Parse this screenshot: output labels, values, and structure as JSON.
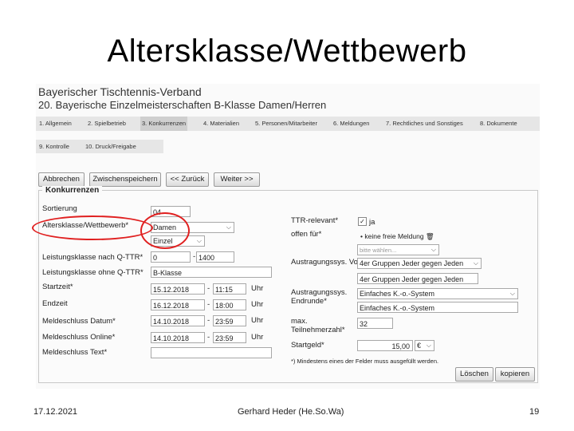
{
  "slide": {
    "title": "Altersklasse/Wettbewerb",
    "footer_date": "17.12.2021",
    "footer_author": "Gerhard Heder (He.So.Wa)",
    "footer_page": "19"
  },
  "header": {
    "org": "Bayerischer Tischtennis-Verband",
    "event": "20. Bayerische Einzelmeisterschaften B-Klasse Damen/Herren"
  },
  "tabs": [
    "1. Allgemein",
    "2. Spielbetrieb",
    "3. Konkurrenzen",
    "4. Materialien",
    "5. Personen/Mitarbeiter",
    "6. Meldungen",
    "7. Rechtliches und Sonstiges",
    "8. Dokumente",
    "9. Kontrolle",
    "10. Druck/Freigabe"
  ],
  "toolbar": {
    "cancel": "Abbrechen",
    "save_draft": "Zwischenspeichern",
    "back": "<< Zurück",
    "next": "Weiter >>"
  },
  "form": {
    "legend": "Konkurrenzen",
    "sort_label": "Sortierung",
    "sort_value": "04",
    "agegroup_label": "Altersklasse/Wettbewerb*",
    "agegroup_value": "Damen",
    "type_value": "Einzel",
    "ttr_label": "Leistungsklasse nach Q-TTR*",
    "ttr_from": "0",
    "ttr_to": "1400",
    "class_label": "Leistungsklasse ohne Q-TTR*",
    "class_value": "B-Klasse",
    "start_label": "Startzeit*",
    "start_date": "15.12.2018",
    "start_time": "11:15",
    "end_label": "Endzeit",
    "end_date": "16.12.2018",
    "end_time": "18:00",
    "entry_date_label": "Meldeschluss Datum*",
    "entry_date": "14.10.2018",
    "entry_date_time": "23:59",
    "entry_online_label": "Meldeschluss Online*",
    "entry_online": "14.10.2018",
    "entry_online_time": "23:59",
    "entry_text_label": "Meldeschluss Text*",
    "dash": "-",
    "uhr": "Uhr",
    "ttr_relevant_label": "TTR-relevant*",
    "ttr_relevant_value": "ja",
    "open_for_label": "offen für*",
    "open_for_value": "keine freie Meldung",
    "open_for_placeholder": "bitte wählen...",
    "prelim_label": "Austragungssys. Vorrunde",
    "prelim_value": "4er Gruppen Jeder gegen Jeden",
    "prelim_value2": "4er Gruppen Jeder gegen Jeden",
    "final_label": "Austragungssys. Endrunde*",
    "final_value": "Einfaches K.-o.-System",
    "final_value2": "Einfaches K.-o.-System",
    "max_label": "max. Teilnehmerzahl*",
    "max_value": "32",
    "fee_label": "Startgeld*",
    "fee_value": "15,00",
    "fee_currency": "€",
    "note": "*) Mindestens eines der Felder muss ausgefüllt werden.",
    "delete": "Löschen",
    "copy": "kopieren"
  }
}
